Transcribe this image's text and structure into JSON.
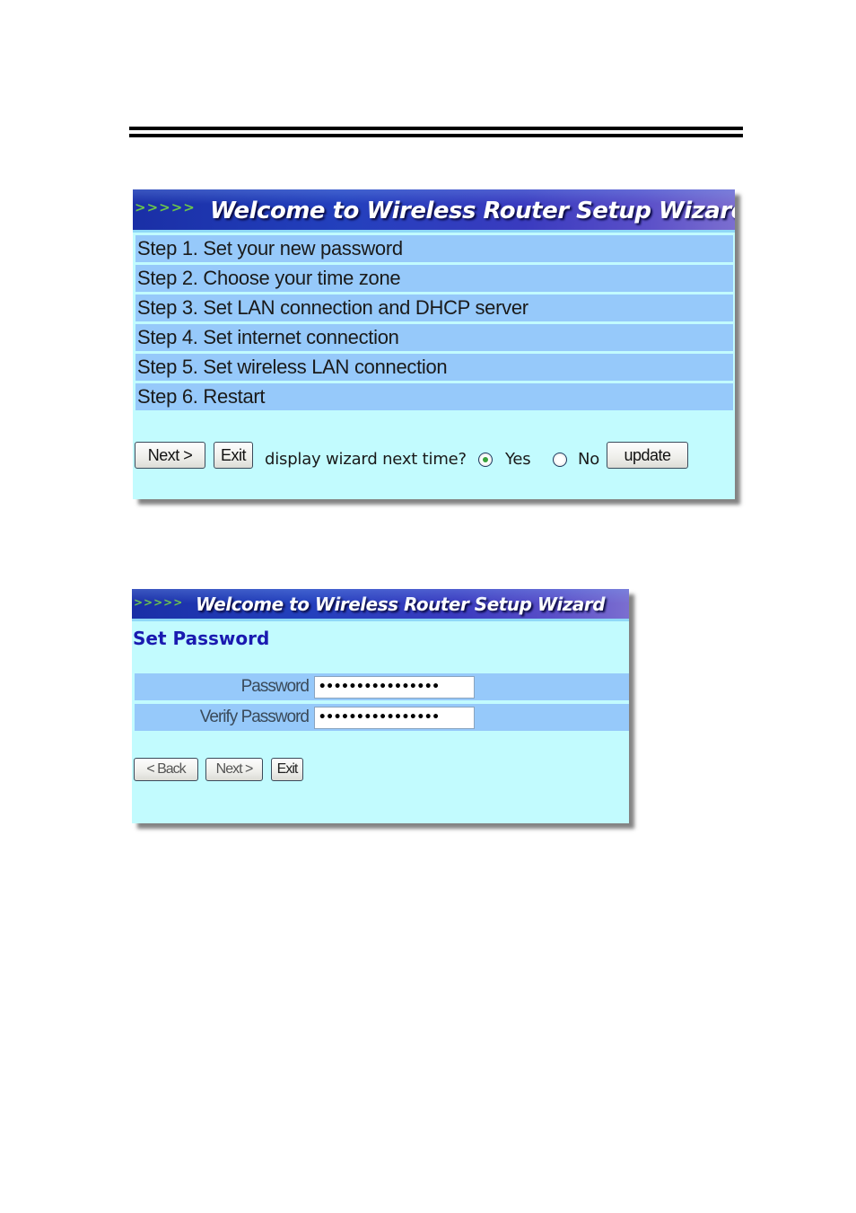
{
  "wizard_main": {
    "header": {
      "chevrons": ">>>>>",
      "title": "Welcome to Wireless Router Setup Wizard"
    },
    "steps": [
      {
        "label": "Step 1. Set your new password"
      },
      {
        "label": "Step 2. Choose your time zone"
      },
      {
        "label": "Step 3. Set LAN connection and DHCP server"
      },
      {
        "label": "Step 4. Set internet connection"
      },
      {
        "label": "Step 5. Set wireless LAN connection"
      },
      {
        "label": "Step 6. Restart"
      }
    ],
    "buttons": {
      "next": "Next >",
      "exit": "Exit",
      "update": "update"
    },
    "display_wizard": {
      "question": "display wizard next time?",
      "options": [
        {
          "label": "Yes",
          "selected": true
        },
        {
          "label": "No",
          "selected": false
        }
      ]
    }
  },
  "wizard_password": {
    "header": {
      "chevrons": ">>>>>",
      "title": "Welcome to Wireless Router Setup Wizard"
    },
    "section_title": "Set Password",
    "fields": [
      {
        "label": "Password",
        "value": "••••••••••••••••"
      },
      {
        "label": "Verify Password",
        "value": "••••••••••••••••"
      }
    ],
    "buttons": {
      "back": "< Back",
      "next": "Next >",
      "exit": "Exit"
    }
  },
  "colors": {
    "panel_background": "#c2fbfe",
    "row_background": "#96c9fa",
    "header_blue": "#2340bd",
    "section_title": "#1a1ab0",
    "radio_dot": "#39a33a"
  }
}
